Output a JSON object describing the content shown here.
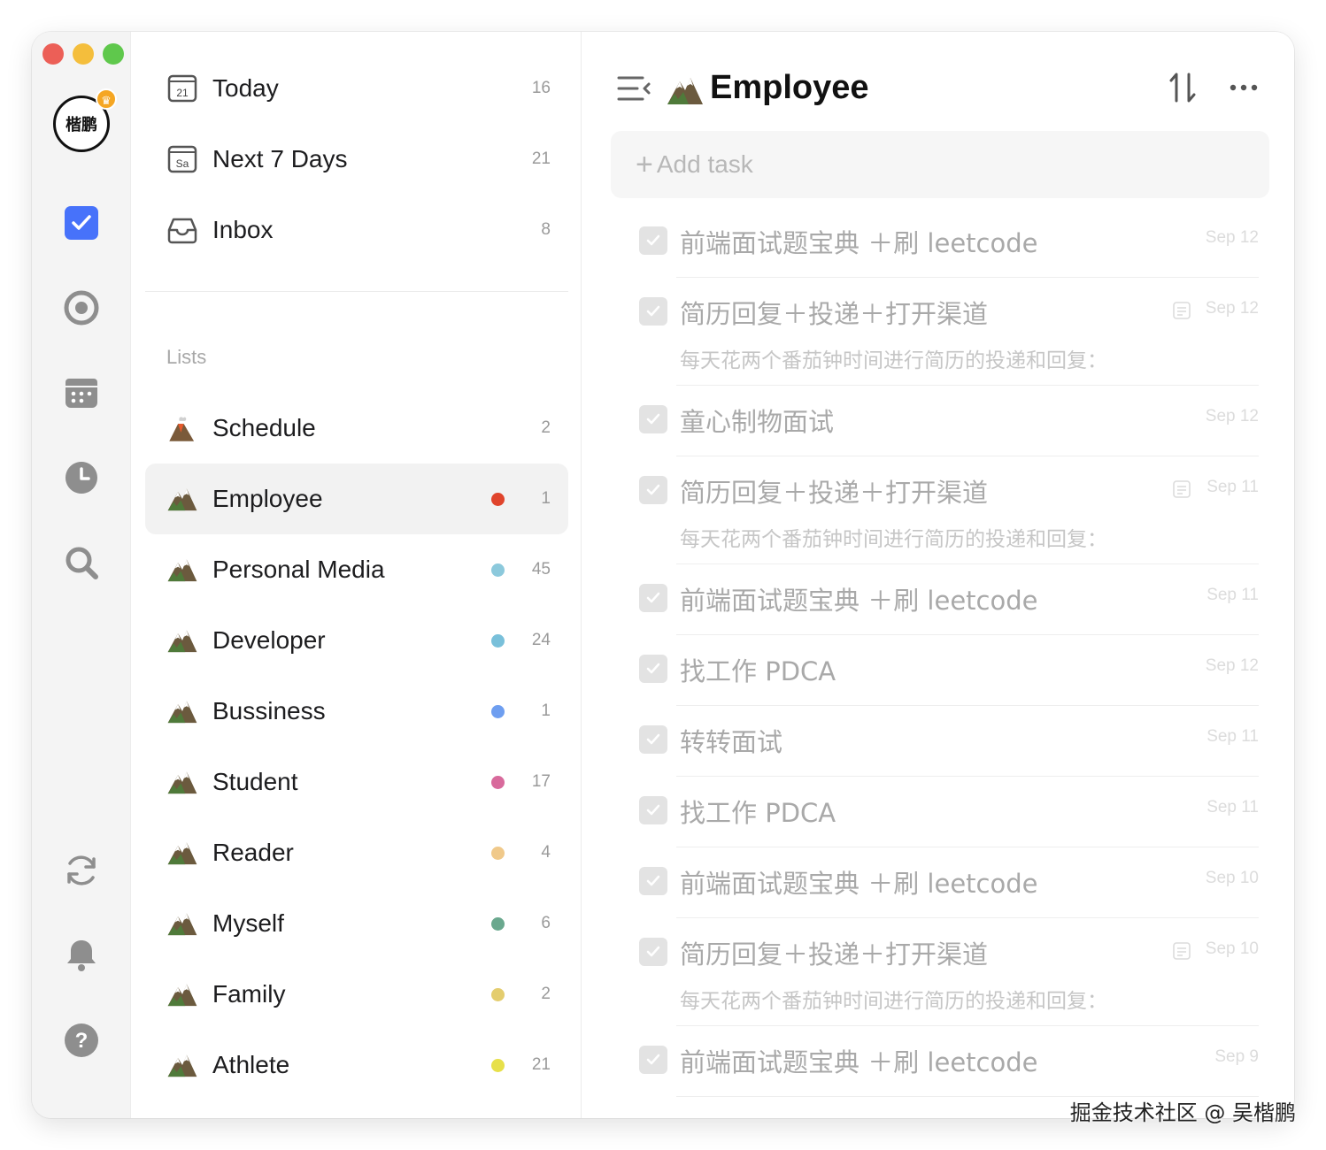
{
  "window": {
    "title": "Employee"
  },
  "user": {
    "avatar_text": "楷鹏",
    "badge": "crown-icon"
  },
  "rail": {
    "items": [
      "task-check-icon",
      "focus-circle-icon",
      "calendar-icon",
      "clock-icon",
      "search-icon",
      "sync-icon",
      "bell-icon",
      "help-icon"
    ]
  },
  "smart_lists": [
    {
      "label": "Today",
      "count": "16",
      "icon_text": "21"
    },
    {
      "label": "Next 7 Days",
      "count": "21",
      "icon_text": "Sa"
    },
    {
      "label": "Inbox",
      "count": "8"
    }
  ],
  "lists_header": "Lists",
  "lists": [
    {
      "label": "Schedule",
      "count": "2",
      "dot": ""
    },
    {
      "label": "Employee",
      "count": "1",
      "dot": "#e0442c"
    },
    {
      "label": "Personal Media",
      "count": "45",
      "dot": "#8cc9dc"
    },
    {
      "label": "Developer",
      "count": "24",
      "dot": "#79c0da"
    },
    {
      "label": "Bussiness",
      "count": "1",
      "dot": "#6e9ef0"
    },
    {
      "label": "Student",
      "count": "17",
      "dot": "#d86a9c"
    },
    {
      "label": "Reader",
      "count": "4",
      "dot": "#f0c98a"
    },
    {
      "label": "Myself",
      "count": "6",
      "dot": "#6aa88e"
    },
    {
      "label": "Family",
      "count": "2",
      "dot": "#e4cd6e"
    },
    {
      "label": "Athlete",
      "count": "21",
      "dot": "#e7e04a"
    }
  ],
  "main": {
    "title": "Employee",
    "add_task_placeholder": "Add task",
    "tasks": [
      {
        "title": "前端面试题宝典 ＋刷 leetcode",
        "date": "Sep 12",
        "completed": true
      },
      {
        "title": "简历回复＋投递＋打开渠道",
        "subtitle": "每天花两个番茄钟时间进行简历的投递和回复：",
        "date": "Sep 12",
        "has_note": true,
        "completed": true
      },
      {
        "title": "童心制物面试",
        "date": "Sep 12",
        "completed": true
      },
      {
        "title": "简历回复＋投递＋打开渠道",
        "subtitle": "每天花两个番茄钟时间进行简历的投递和回复：",
        "date": "Sep 11",
        "has_note": true,
        "completed": true
      },
      {
        "title": "前端面试题宝典 ＋刷 leetcode",
        "date": "Sep 11",
        "completed": true
      },
      {
        "title": "找工作 PDCA",
        "date": "Sep 12",
        "completed": true
      },
      {
        "title": "转转面试",
        "date": "Sep 11",
        "completed": true
      },
      {
        "title": "找工作 PDCA",
        "date": "Sep 11",
        "completed": true
      },
      {
        "title": "前端面试题宝典 ＋刷 leetcode",
        "date": "Sep 10",
        "completed": true
      },
      {
        "title": "简历回复＋投递＋打开渠道",
        "subtitle": "每天花两个番茄钟时间进行简历的投递和回复：",
        "date": "Sep 10",
        "has_note": true,
        "completed": true
      },
      {
        "title": "前端面试题宝典 ＋刷 leetcode",
        "date": "Sep 9",
        "completed": true
      }
    ]
  },
  "watermark": "掘金技术社区 @ 吴楷鹏"
}
